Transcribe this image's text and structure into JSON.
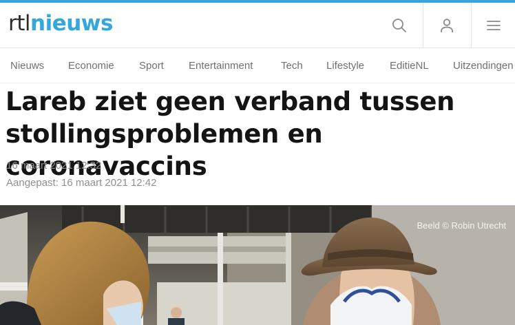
{
  "brand": {
    "logo_prefix": "rtl",
    "logo_suffix": "nieuws",
    "accent_color": "#37a6d8"
  },
  "header_icons": {
    "search": "search-icon",
    "user": "user-icon",
    "menu": "hamburger-menu-icon"
  },
  "nav": {
    "items": [
      {
        "label": "Nieuws"
      },
      {
        "label": "Economie"
      },
      {
        "label": "Sport"
      },
      {
        "label": "Entertainment"
      },
      {
        "label": "Tech"
      },
      {
        "label": "Lifestyle"
      },
      {
        "label": "EditieNL"
      },
      {
        "label": "Uitzendingen"
      }
    ]
  },
  "article": {
    "headline": "Lareb ziet geen verband tussen stollingsproblemen en coronavaccins",
    "published": "16 maart 2021 12:32",
    "updated": "Aangepast: 16 maart 2021 12:42",
    "image_credit": "Beeld © Robin Utrecht"
  }
}
